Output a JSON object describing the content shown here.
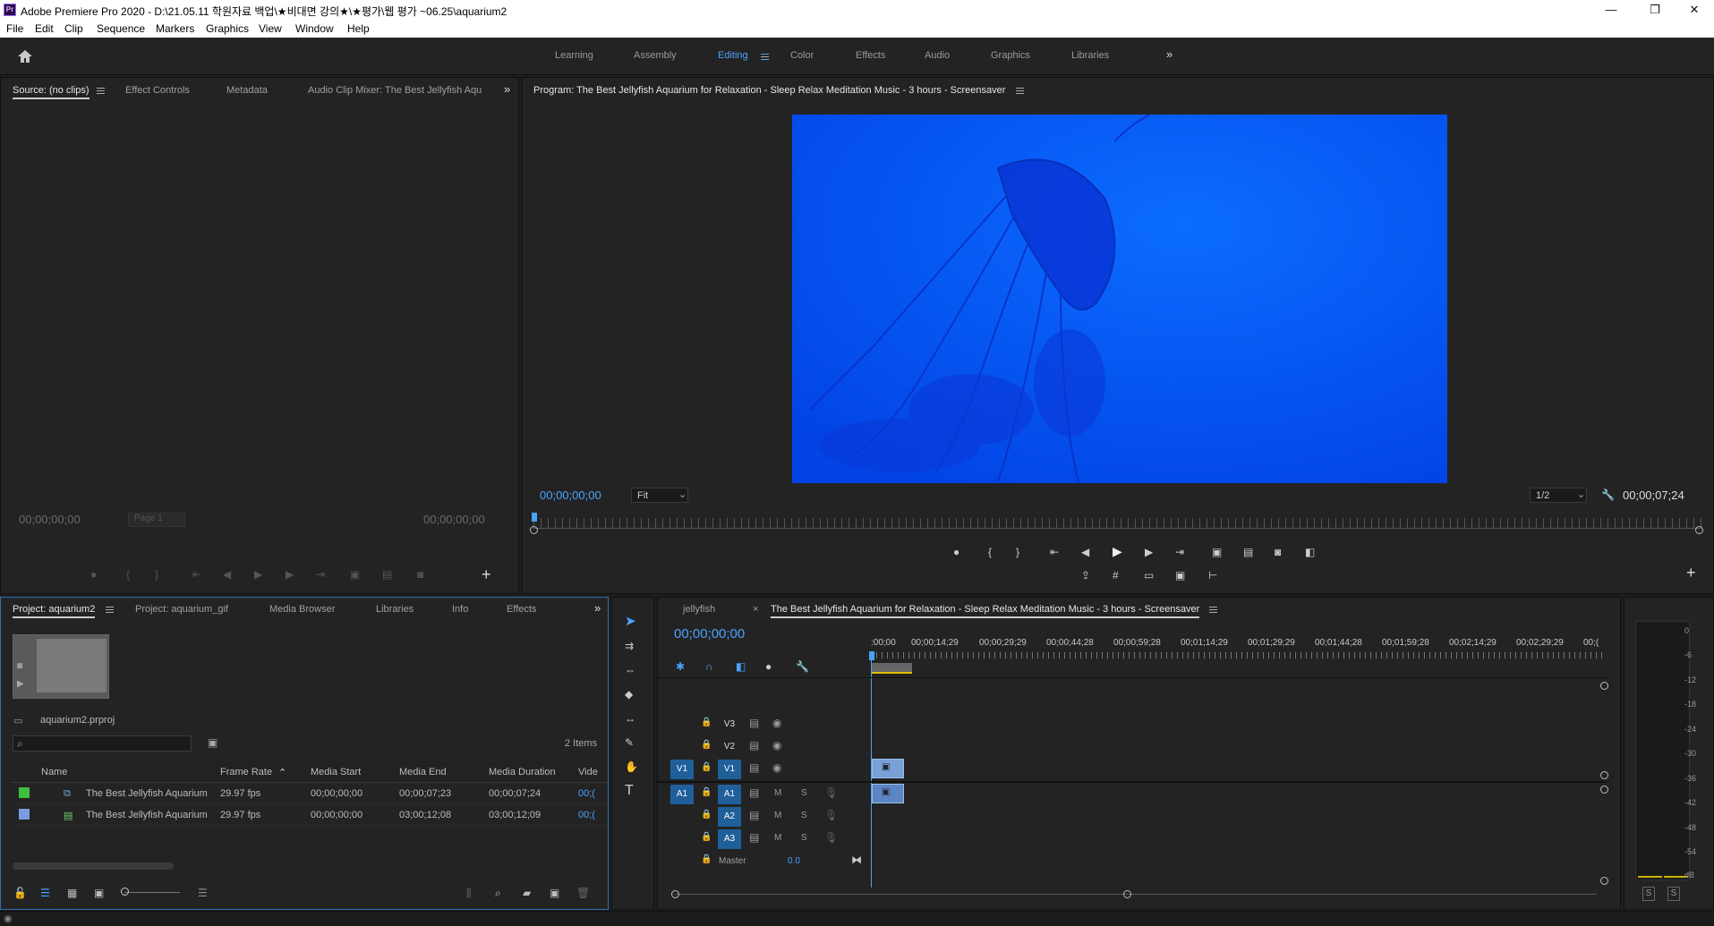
{
  "titlebar": {
    "app_icon": "Pr",
    "title": "Adobe Premiere Pro 2020 - D:\\21.05.11 학원자료 백업\\★비대면 강의★\\★평가\\웹 평가 ~06.25\\aquarium2",
    "minimize": "—",
    "restore": "❐",
    "close": "✕"
  },
  "menu": [
    "File",
    "Edit",
    "Clip",
    "Sequence",
    "Markers",
    "Graphics",
    "View",
    "Window",
    "Help"
  ],
  "workspaces": {
    "items": [
      "Learning",
      "Assembly",
      "Editing",
      "Color",
      "Effects",
      "Audio",
      "Graphics",
      "Libraries"
    ],
    "active": "Editing",
    "more": "»"
  },
  "source_panel": {
    "tabs": [
      "Source: (no clips)",
      "Effect Controls",
      "Metadata",
      "Audio Clip Mixer: The Best Jellyfish Aqu"
    ],
    "timecode_left": "00;00;00;00",
    "timecode_right": "00;00;00;00",
    "page": "Page 1"
  },
  "program_panel": {
    "title": "Program: The Best Jellyfish Aquarium for Relaxation - Sleep Relax Meditation Music - 3 hours - Screensaver",
    "timecode": "00;00;00;00",
    "fit": "Fit",
    "resolution": "1/2",
    "duration": "00;00;07;24",
    "colors": {
      "frame": "#0a5cff"
    }
  },
  "project_panel": {
    "tabs": [
      "Project: aquarium2",
      "Project: aquarium_gif",
      "Media Browser",
      "Libraries",
      "Info",
      "Effects"
    ],
    "file": "aquarium2.prproj",
    "items_count": "2 Items",
    "columns": [
      "Name",
      "Frame Rate",
      "Media Start",
      "Media End",
      "Media Duration",
      "Vide"
    ],
    "rows": [
      {
        "color": "#3fbf3f",
        "name": "The Best Jellyfish Aquarium",
        "frame_rate": "29.97 fps",
        "start": "00;00;00;00",
        "end": "00;00;07;23",
        "duration": "00;00;07;24",
        "vid": "00;("
      },
      {
        "color": "#7a9be0",
        "name": "The Best Jellyfish Aquarium",
        "frame_rate": "29.97 fps",
        "start": "00;00;00;00",
        "end": "03;00;12;08",
        "duration": "03;00;12;09",
        "vid": "00;("
      }
    ]
  },
  "timeline": {
    "tabs": [
      "jellyfish",
      "The Best Jellyfish Aquarium for Relaxation - Sleep Relax Meditation Music - 3 hours - Screensaver"
    ],
    "close": "×",
    "timecode": "00;00;00;00",
    "ruler": [
      ":00;00",
      "00;00;14;29",
      "00;00;29;29",
      "00;00;44;28",
      "00;00;59;28",
      "00;01;14;29",
      "00;01;29;29",
      "00;01;44;28",
      "00;01;59;28",
      "00;02;14;29",
      "00;02;29;29",
      "00;("
    ],
    "video_tracks": [
      "V3",
      "V2",
      "V1"
    ],
    "audio_tracks": [
      "A1",
      "A2",
      "A3"
    ],
    "source_v": "V1",
    "source_a": "A1",
    "mute": "M",
    "solo": "S",
    "master_label": "Master",
    "master_value": "0.0"
  },
  "meter": {
    "scale": [
      "0",
      "-6",
      "-12",
      "-18",
      "-24",
      "-30",
      "-36",
      "-42",
      "-48",
      "-54",
      "dB"
    ],
    "solo_buttons": [
      "S",
      "S"
    ]
  },
  "tools": [
    "selection-tool",
    "track-select-tool",
    "ripple-edit-tool",
    "razor-tool",
    "slip-tool",
    "pen-tool",
    "hand-tool",
    "type-tool"
  ],
  "type_tool_glyph": "T"
}
